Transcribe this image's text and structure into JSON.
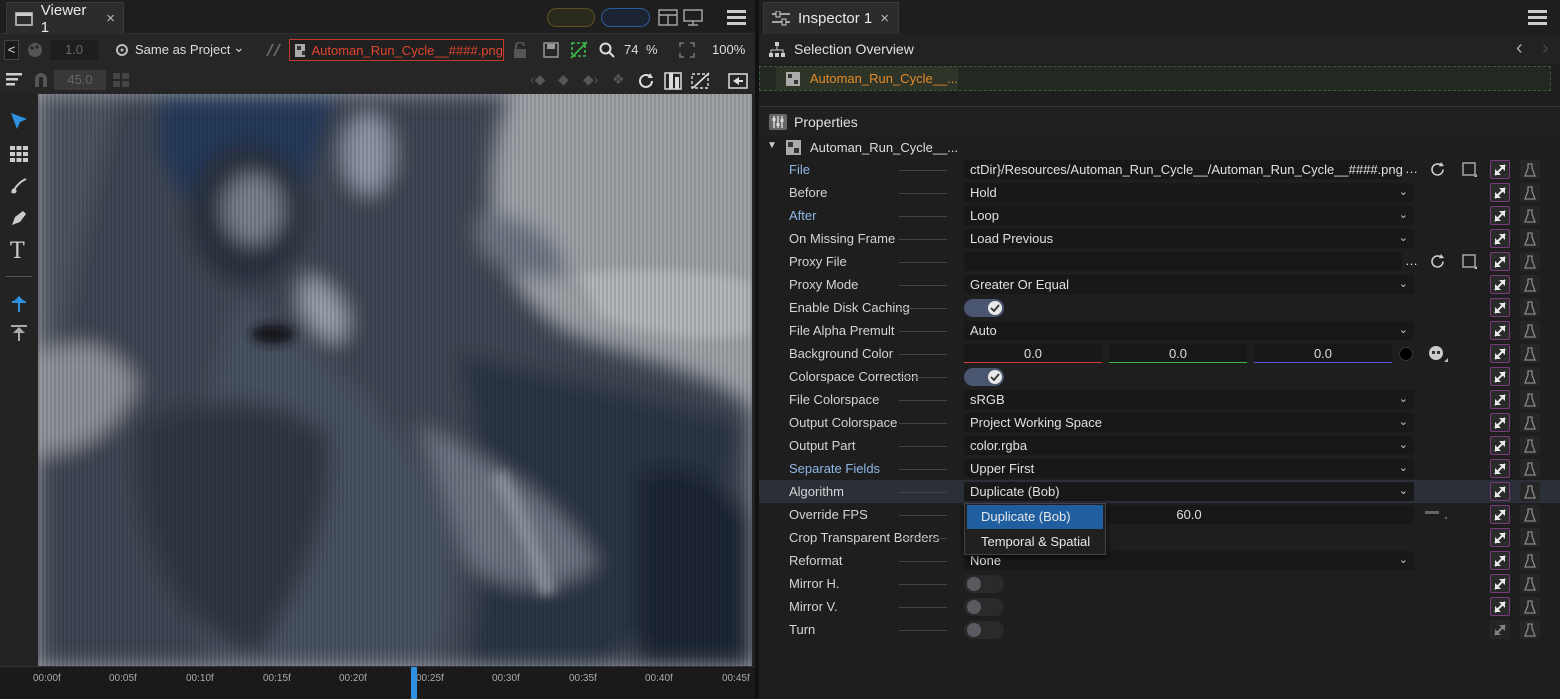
{
  "viewer": {
    "tab_title": "Viewer 1",
    "close": "×",
    "back_label": "<",
    "exposure_value": "1.0",
    "colorspace_select": "Same as Project",
    "file_name": "Automan_Run_Cycle__####.png",
    "zoom_value": "74",
    "zoom_unit": "%",
    "zoom_percent": "100%",
    "angle_value": "45.0",
    "timeline_ticks": [
      "00:00f",
      "00:05f",
      "00:10f",
      "00:15f",
      "00:20f",
      "00:25f",
      "00:30f",
      "00:35f",
      "00:40f",
      "00:45f"
    ]
  },
  "inspector": {
    "tab_title": "Inspector 1",
    "close": "×",
    "selection_header": "Selection Overview",
    "selection_item": "Automan_Run_Cycle__...",
    "properties_header": "Properties",
    "node_name": "Automan_Run_Cycle__...",
    "properties": [
      {
        "label": "File",
        "value": "ctDir}/Resources/Automan_Run_Cycle__/Automan_Run_Cycle__####.png",
        "kind": "file",
        "blue": true
      },
      {
        "label": "Before",
        "value": "Hold",
        "kind": "select"
      },
      {
        "label": "After",
        "value": "Loop",
        "kind": "select",
        "blue": true
      },
      {
        "label": "On Missing Frame",
        "value": "Load Previous",
        "kind": "select"
      },
      {
        "label": "Proxy File",
        "value": "",
        "kind": "file"
      },
      {
        "label": "Proxy Mode",
        "value": "Greater Or Equal",
        "kind": "select"
      },
      {
        "label": "Enable Disk Caching",
        "value": "on",
        "kind": "toggle"
      },
      {
        "label": "File Alpha Premult",
        "value": "Auto",
        "kind": "select"
      },
      {
        "label": "Background Color",
        "value": "",
        "kind": "color"
      },
      {
        "label": "Colorspace Correction",
        "value": "on",
        "kind": "toggle"
      },
      {
        "label": "File Colorspace",
        "value": "sRGB",
        "kind": "select"
      },
      {
        "label": "Output Colorspace",
        "value": "Project Working Space",
        "kind": "select"
      },
      {
        "label": "Output Part",
        "value": "color.rgba",
        "kind": "select"
      },
      {
        "label": "Separate Fields",
        "value": "Upper First",
        "kind": "select",
        "blue": true
      },
      {
        "label": "Algorithm",
        "value": "Duplicate (Bob)",
        "kind": "select",
        "active": true
      },
      {
        "label": "Override FPS",
        "value": "60.0",
        "kind": "number"
      },
      {
        "label": "Crop Transparent Borders",
        "value": "",
        "kind": "blank"
      },
      {
        "label": "Reformat",
        "value": "None",
        "kind": "select"
      },
      {
        "label": "Mirror H.",
        "value": "off",
        "kind": "toggle"
      },
      {
        "label": "Mirror V.",
        "value": "off",
        "kind": "toggle"
      },
      {
        "label": "Turn",
        "value": "off",
        "kind": "toggle"
      }
    ],
    "bg_color": {
      "r": "0.0",
      "g": "0.0",
      "b": "0.0"
    },
    "dropdown": {
      "options": [
        "Duplicate (Bob)",
        "Temporal & Spatial"
      ],
      "selected": "Duplicate (Bob)"
    }
  },
  "colors": {
    "accent": "#1f5fa0",
    "file_red": "#e0452e",
    "selection_orange": "#e38a2a",
    "key_magenta": "#7a3b7a"
  }
}
